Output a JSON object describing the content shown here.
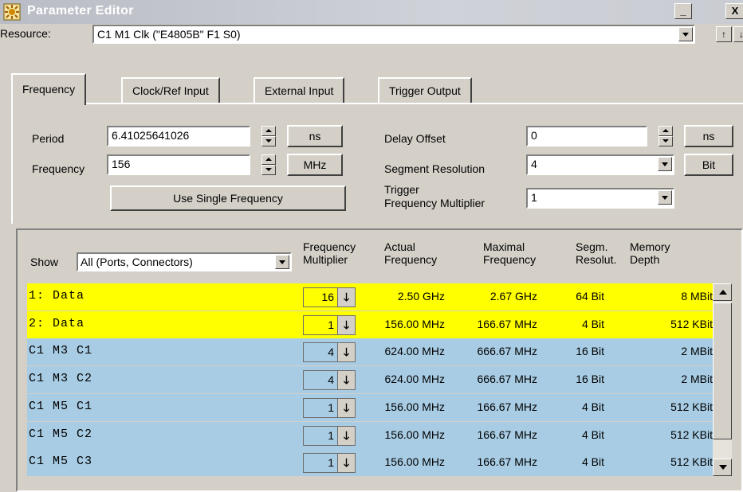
{
  "window": {
    "title": "Parameter Editor",
    "min_glyph": "_",
    "close_glyph": "X"
  },
  "resource": {
    "label": "Resource:",
    "value": "C1 M1 Clk (\"E4805B\" F1 S0)",
    "up_glyph": "↑",
    "down_glyph": "↓"
  },
  "tabs": [
    {
      "label": "Frequency",
      "active": true
    },
    {
      "label": "Clock/Ref Input",
      "active": false
    },
    {
      "label": "External Input",
      "active": false
    },
    {
      "label": "Trigger Output",
      "active": false
    }
  ],
  "frequency_tab": {
    "period_label": "Period",
    "period_value": "6.41025641026",
    "period_unit": "ns",
    "frequency_label": "Frequency",
    "frequency_value": "156",
    "frequency_unit": "MHz",
    "single_freq_button": "Use Single Frequency",
    "delay_offset_label": "Delay Offset",
    "delay_offset_value": "0",
    "delay_offset_unit": "ns",
    "segment_resolution_label": "Segment Resolution",
    "segment_resolution_value": "4",
    "segment_resolution_unit": "Bit",
    "trigger_mult_label_line1": "Trigger",
    "trigger_mult_label_line2": "Frequency Multiplier",
    "trigger_mult_value": "1"
  },
  "table": {
    "show_label": "Show",
    "show_value": "All (Ports, Connectors)",
    "headers": {
      "mult_1": "Frequency",
      "mult_2": "Multiplier",
      "actual_1": "Actual",
      "actual_2": "Frequency",
      "max_1": "Maximal",
      "max_2": "Frequency",
      "seg_1": "Segm.",
      "seg_2": "Resolut.",
      "mem_1": "Memory",
      "mem_2": "Depth"
    },
    "rows": [
      {
        "name": "1: Data",
        "mult": "16",
        "actual": "2.50 GHz",
        "max": "2.67 GHz",
        "seg": "64 Bit",
        "mem": "8 MBit",
        "color": "#ffff00"
      },
      {
        "name": "2: Data",
        "mult": "1",
        "actual": "156.00 MHz",
        "max": "166.67 MHz",
        "seg": "4 Bit",
        "mem": "512 KBit",
        "color": "#ffff00"
      },
      {
        "name": "C1 M3 C1",
        "mult": "4",
        "actual": "624.00 MHz",
        "max": "666.67 MHz",
        "seg": "16 Bit",
        "mem": "2 MBit",
        "color": "#a8cce4"
      },
      {
        "name": "C1 M3 C2",
        "mult": "4",
        "actual": "624.00 MHz",
        "max": "666.67 MHz",
        "seg": "16 Bit",
        "mem": "2 MBit",
        "color": "#a8cce4"
      },
      {
        "name": "C1 M5 C1",
        "mult": "1",
        "actual": "156.00 MHz",
        "max": "166.67 MHz",
        "seg": "4 Bit",
        "mem": "512 KBit",
        "color": "#a8cce4"
      },
      {
        "name": "C1 M5 C2",
        "mult": "1",
        "actual": "156.00 MHz",
        "max": "166.67 MHz",
        "seg": "4 Bit",
        "mem": "512 KBit",
        "color": "#a8cce4"
      },
      {
        "name": "C1 M5 C3",
        "mult": "1",
        "actual": "156.00 MHz",
        "max": "166.67 MHz",
        "seg": "4 Bit",
        "mem": "512 KBit",
        "color": "#a8cce4"
      }
    ],
    "arrow_glyph": "🡓"
  }
}
